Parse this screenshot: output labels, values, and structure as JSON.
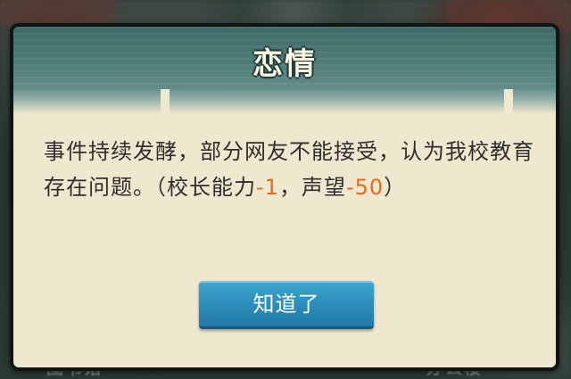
{
  "background": {
    "left_building_label": "图书馆",
    "right_building_label": "办公楼"
  },
  "dialog": {
    "title": "恋情",
    "message_part1": "事件持续发酵，部分网友不能接受，认为我校教育存在问题。（校长能力",
    "principal_ability_change": "-1",
    "message_part2": "，声望",
    "reputation_change": "-50",
    "message_part3": "）",
    "ok_label": "知道了"
  },
  "colors": {
    "highlight": "#e36a1f",
    "button": "#2d8fbc",
    "panel": "#efe8cf",
    "header": "#4f7c78"
  }
}
